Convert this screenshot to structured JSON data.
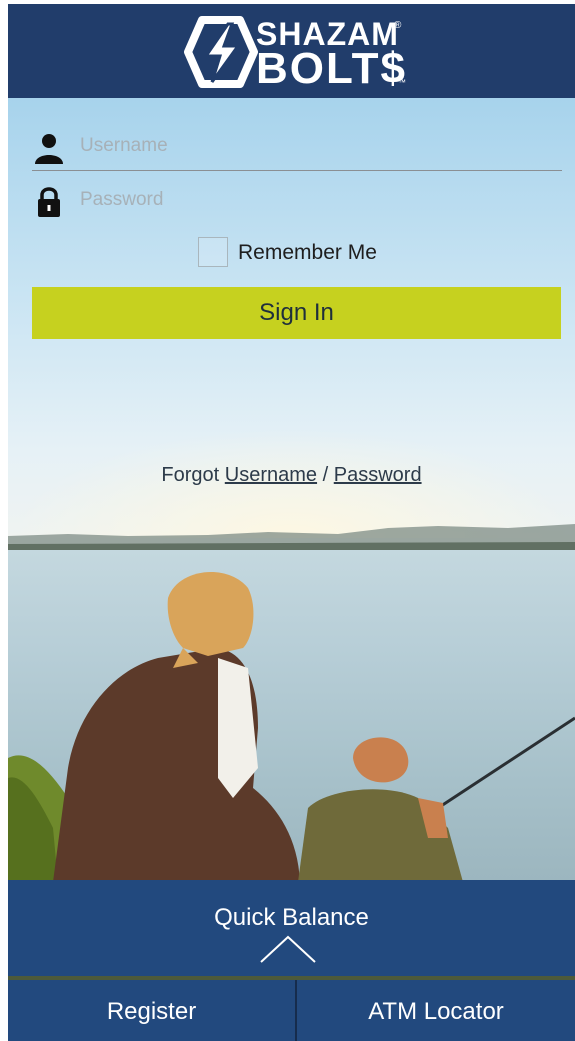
{
  "header": {
    "logo_line1": "SHAZAM",
    "logo_line2": "BOLT$",
    "logo_mark": "®",
    "logo_tm": "™"
  },
  "login": {
    "username_placeholder": "Username",
    "password_placeholder": "Password",
    "remember_label": "Remember Me",
    "remember_checked": false,
    "signin_label": "Sign In"
  },
  "forgot": {
    "prefix": "Forgot",
    "username_link": "Username",
    "separator": "/",
    "password_link": "Password"
  },
  "quick_balance": {
    "label": "Quick Balance",
    "chevron_icon": "chevron-up-icon"
  },
  "bottom_nav": {
    "register_label": "Register",
    "atm_label": "ATM Locator"
  },
  "colors": {
    "header_bg": "#213d6b",
    "signin_bg": "#c6d11f",
    "nav_bg": "#22497e"
  }
}
